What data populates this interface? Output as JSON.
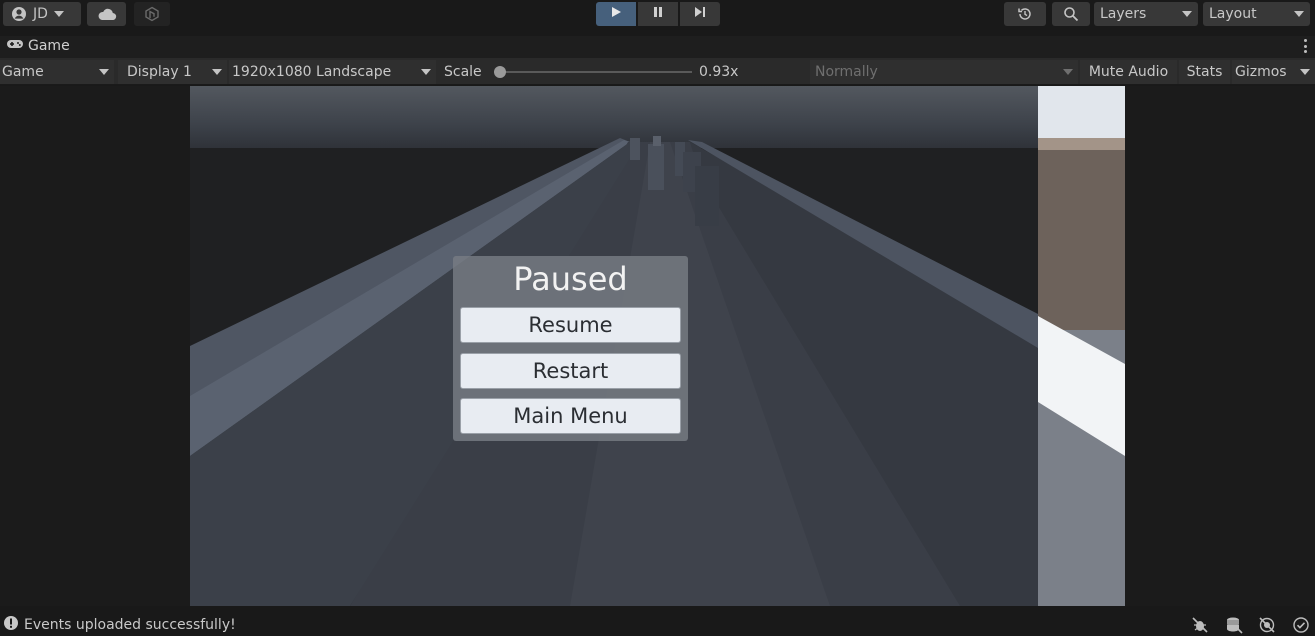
{
  "toolbar": {
    "account_label": "JD",
    "layers_label": "Layers",
    "layout_label": "Layout"
  },
  "game_tab": {
    "title": "Game"
  },
  "game_controls": {
    "view_mode": "Game",
    "display": "Display 1",
    "resolution": "1920x1080 Landscape",
    "scale_label": "Scale",
    "scale_value": "0.93x",
    "play_mode": "Normally",
    "mute_audio": "Mute Audio",
    "stats": "Stats",
    "gizmos": "Gizmos"
  },
  "pause_menu": {
    "title": "Paused",
    "buttons": [
      "Resume",
      "Restart",
      "Main Menu"
    ]
  },
  "status": {
    "message": "Events uploaded successfully!"
  },
  "colors": {
    "play_active": "#46607c",
    "panel_bg": "#383838",
    "editor_bg": "#191919"
  }
}
